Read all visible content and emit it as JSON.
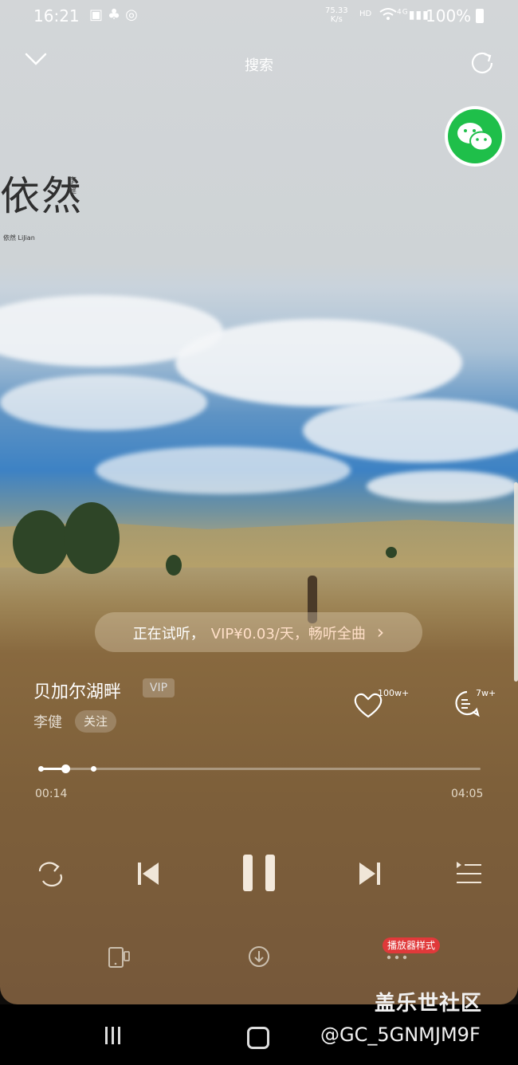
{
  "status_bar": {
    "time": "16:21",
    "net_speed_value": "75.33",
    "net_speed_unit": "K/s",
    "hd": "HD",
    "signal_label": "4G",
    "battery": "100%"
  },
  "topbar": {
    "title": "搜索"
  },
  "poster": {
    "title_text": "依然",
    "artist_small": "李健",
    "credit": "依然 LiJian"
  },
  "trial_banner": {
    "prefix": "正在试听，",
    "offer": "VIP¥0.03/天，畅听全曲",
    "arrow": "›"
  },
  "song": {
    "title": "贝加尔湖畔",
    "vip_badge": "VIP",
    "artist": "李健",
    "follow_label": "关注"
  },
  "stats": {
    "likes": "100w+",
    "comments": "7w+"
  },
  "progress": {
    "current": "00:14",
    "total": "04:05",
    "played_fraction": 0.057,
    "buffer_fraction": 0.122
  },
  "bottom_bar": {
    "player_style_label": "播放器样式"
  },
  "watermark": {
    "line1": "盖乐世社区",
    "line2": "@GC_5GNMJM9F"
  },
  "colors": {
    "wechat_green": "#1fbf4a",
    "style_tag_red": "#e0393a",
    "trial_offer": "#ffdfc8"
  },
  "icons": [
    "chevron-down-icon",
    "share-icon",
    "wechat-icon",
    "heart-icon",
    "comment-icon",
    "repeat-icon",
    "previous-icon",
    "pause-icon",
    "next-icon",
    "playlist-icon",
    "device-icon",
    "download-icon",
    "more-icon"
  ]
}
